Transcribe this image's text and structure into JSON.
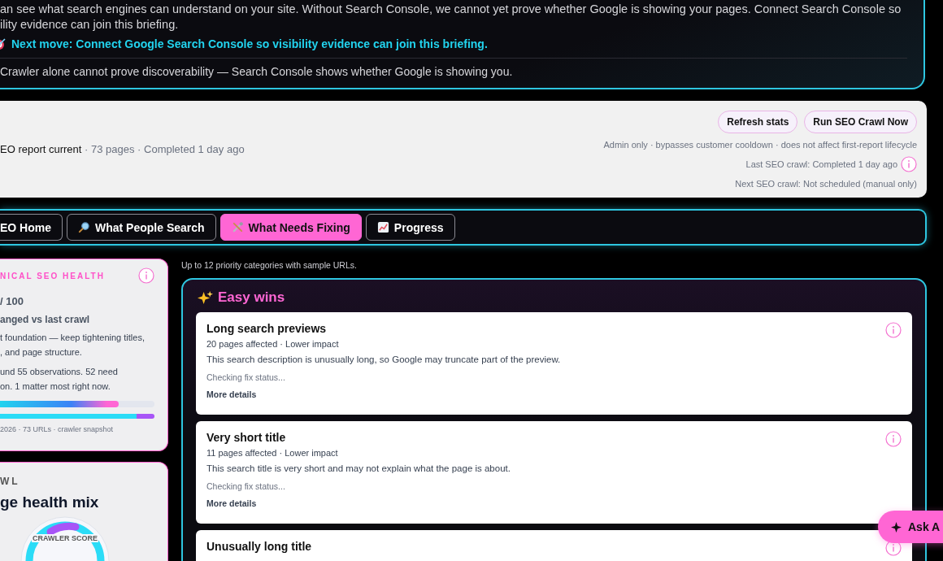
{
  "briefing": {
    "intro_lines": [
      "an see what search engines can understand on your site. Without Search Console, we cannot yet prove whether Google is showing your pages. Connect Search Console so",
      "ility evidence can join this briefing."
    ],
    "next_move": "Next move: Connect Google Search Console so visibility evidence can join this briefing.",
    "footnote": "Crawler alone cannot prove discoverability — Search Console shows whether Google is showing you."
  },
  "status": {
    "summary": "**EO report current** · 73 pages · Completed 1 day ago",
    "buttons": [
      "Refresh stats",
      "Run SEO Crawl Now"
    ],
    "admin_note": "Admin only · bypasses customer cooldown · does not affect first-report lifecycle",
    "last_crawl": "Last SEO crawl: Completed 1 day ago",
    "next_crawl": "Next SEO crawl: Not scheduled (manual only)"
  },
  "tabs": [
    {
      "label": "EO Home",
      "kind": "plain",
      "selected": false
    },
    {
      "label": "What People Search",
      "kind": "search",
      "selected": false
    },
    {
      "label": "What Needs Fixing",
      "kind": "tools",
      "selected": true
    },
    {
      "label": "Progress",
      "kind": "chart",
      "selected": false
    }
  ],
  "health_card": {
    "eyebrow": "NICAL SEO HEALTH",
    "score": "/ 100",
    "change": "anged vs last crawl",
    "summary_lines": [
      "t foundation — keep tightening titles,",
      ", and page structure."
    ],
    "observation_lines": [
      "und 55 observations. 52 need",
      "on. 1 matter most right now."
    ],
    "health_bar": {
      "level": 0.77
    },
    "mix_bar": {
      "level": 0.885
    },
    "footer": "2026 · 73 URLs · crawler snapshot"
  },
  "mix_card": {
    "eyebrow": "WL",
    "title": "ge health mix",
    "gauge_label": "CRAWLER SCORE"
  },
  "fixes": {
    "note": "Up to 12 priority categories with sample URLs.",
    "group_title": "Easy wins",
    "issues": [
      {
        "title": "Long search previews",
        "meta": "20 pages affected · Lower impact",
        "description": "This search description is unusually long, so Google may truncate part of the preview.",
        "status": "Checking fix status...",
        "link": "More details"
      },
      {
        "title": "Very short title",
        "meta": "11 pages affected · Lower impact",
        "description": "This search title is very short and may not explain what the page is about.",
        "status": "Checking fix status...",
        "link": "More details"
      },
      {
        "title": "Unusually long title"
      }
    ]
  },
  "assistant_button": "Ask A"
}
